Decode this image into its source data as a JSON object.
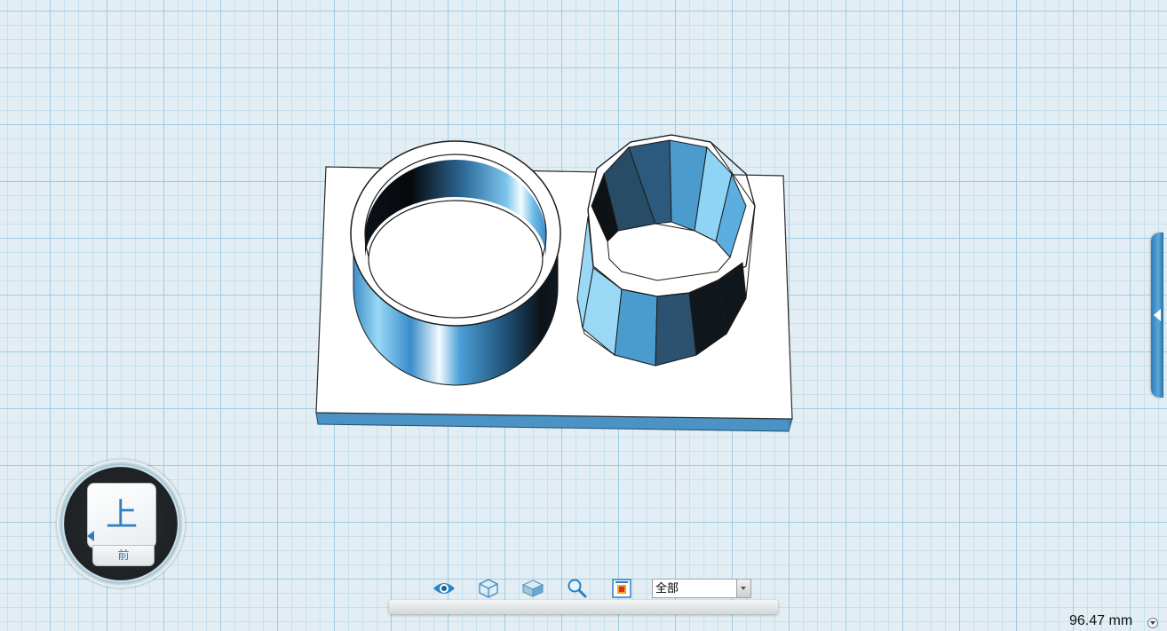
{
  "viewport": {
    "background": "#e2eef4",
    "grid_color": "#9fcde2",
    "model_color": "#5aa6d8"
  },
  "view_cube": {
    "top_label": "上",
    "front_label": "前"
  },
  "toolbar": {
    "icons": [
      "eye-icon",
      "wireframe-cube-icon",
      "shaded-cube-icon",
      "zoom-icon",
      "layer-color-icon"
    ],
    "filter_value": "全部"
  },
  "status": {
    "measurement": "96.47 mm"
  }
}
